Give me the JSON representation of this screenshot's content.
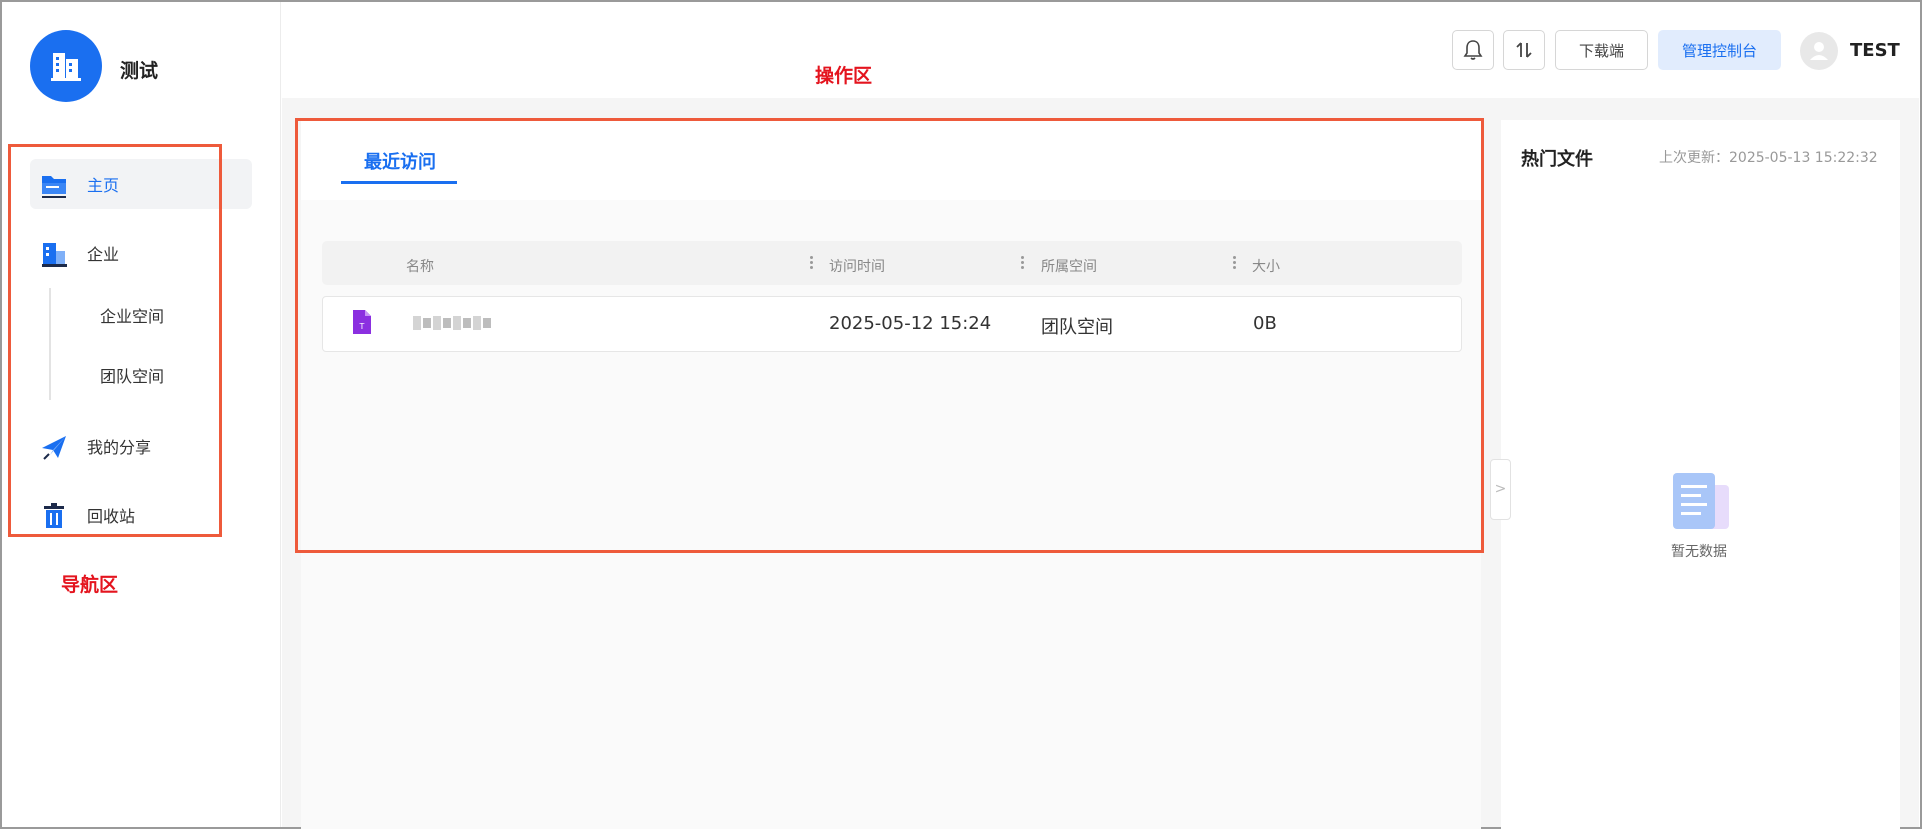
{
  "app": {
    "name": "测试"
  },
  "sidebar": {
    "items": [
      {
        "label": "主页",
        "icon": "folder-icon",
        "active": true
      },
      {
        "label": "企业",
        "icon": "building-icon",
        "active": false
      },
      {
        "label": "我的分享",
        "icon": "paper-plane-icon",
        "active": false
      },
      {
        "label": "回收站",
        "icon": "trash-icon",
        "active": false
      }
    ],
    "subitems": [
      {
        "label": "企业空间"
      },
      {
        "label": "团队空间"
      }
    ]
  },
  "annotations": {
    "operation_area": "操作区",
    "navigation_area": "导航区",
    "box_color": "#ee5a3b",
    "label_color": "#e4141e"
  },
  "header": {
    "bell_icon": "bell-icon",
    "sort_icon": "sort-icon",
    "download_label": "下载端",
    "admin_console_label": "管理控制台",
    "username": "TEST"
  },
  "main": {
    "tabs": [
      {
        "label": "最近访问",
        "active": true
      }
    ],
    "table": {
      "columns": [
        "名称",
        "访问时间",
        "所属空间",
        "大小"
      ],
      "rows": [
        {
          "name": "",
          "visit_time": "2025-05-12 15:24",
          "space": "团队空间",
          "size": "0B",
          "file_icon": "text-file-icon"
        }
      ]
    }
  },
  "hot_files": {
    "title": "热门文件",
    "last_updated_label": "上次更新：2025-05-13 15:22:32",
    "empty_text": "暂无数据",
    "collapse_glyph": ">"
  },
  "colors": {
    "accent": "#1a6ff0",
    "primary_button_bg": "#e1ecfd",
    "file_icon": "#8b2fe0"
  }
}
